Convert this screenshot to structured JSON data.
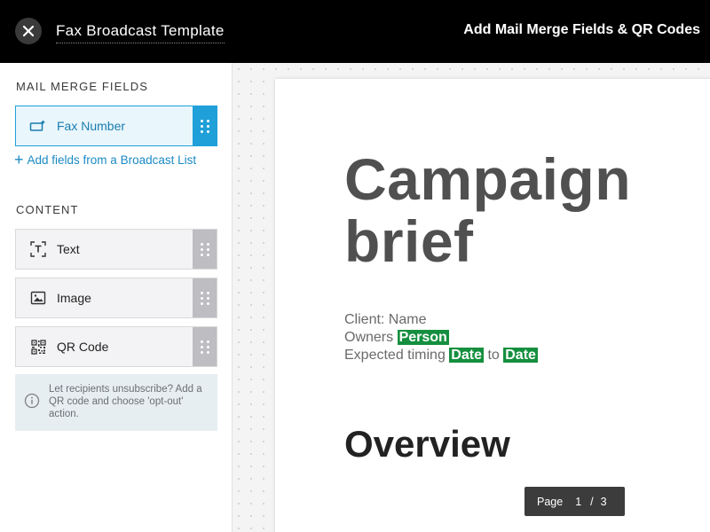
{
  "header": {
    "document_title": "Fax Broadcast Template",
    "right_title": "Add Mail Merge Fields & QR Codes"
  },
  "sidebar": {
    "merge_section_title": "MAIL MERGE FIELDS",
    "merge_fields": [
      {
        "label": "Fax Number",
        "icon": "field-sparkle-icon"
      }
    ],
    "add_fields_link": "Add fields from a Broadcast List",
    "content_section_title": "CONTENT",
    "content_items": [
      {
        "label": "Text",
        "icon": "text-box-icon"
      },
      {
        "label": "Image",
        "icon": "image-icon"
      },
      {
        "label": "QR Code",
        "icon": "qr-code-icon"
      }
    ],
    "info_text": "Let recipients unsubscribe? Add a QR code and choose 'opt-out' action."
  },
  "document": {
    "heading_line1": "Campaign",
    "heading_line2": "brief",
    "client_line": "Client: Name",
    "owners_label": "Owners",
    "owners_tag": "Person",
    "timing_label": "Expected timing",
    "timing_tag_start": "Date",
    "timing_connector": "to",
    "timing_tag_end": "Date",
    "overview_heading": "Overview"
  },
  "pager": {
    "label": "Page",
    "current": "1",
    "separator": "/",
    "total": "3"
  },
  "colors": {
    "header_bg": "#000000",
    "accent_blue": "#1fa0d8",
    "merge_tag_green": "#158f3f",
    "pager_bg": "#3c3c3c"
  }
}
